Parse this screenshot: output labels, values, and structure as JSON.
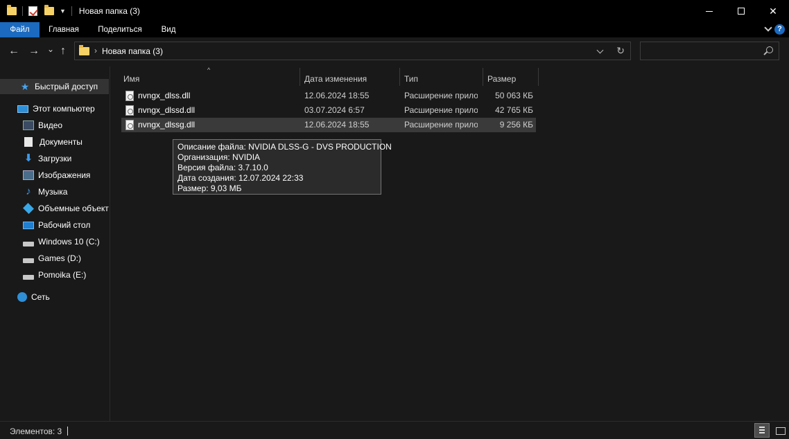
{
  "window": {
    "title": "Новая папка (3)",
    "minimize_glyph": "",
    "close_glyph": "✕"
  },
  "ribbon": {
    "tabs": [
      "Файл",
      "Главная",
      "Поделиться",
      "Вид"
    ],
    "active_tab": "Файл",
    "help_glyph": "?"
  },
  "nav": {
    "back_glyph": "←",
    "forward_glyph": "→",
    "recent_glyph": "⌄",
    "up_glyph": "↑",
    "address_separator": "›",
    "address_path": "Новая папка (3)",
    "refresh_glyph": "↻",
    "search_placeholder": ""
  },
  "sidebar": {
    "items": [
      {
        "label": "Быстрый доступ",
        "icon": "star-icon"
      },
      {
        "label": "Этот компьютер",
        "icon": "computer-icon"
      },
      {
        "label": "Видео",
        "icon": "video-folder-icon"
      },
      {
        "label": "Документы",
        "icon": "documents-folder-icon"
      },
      {
        "label": "Загрузки",
        "icon": "downloads-folder-icon"
      },
      {
        "label": "Изображения",
        "icon": "pictures-folder-icon"
      },
      {
        "label": "Музыка",
        "icon": "music-folder-icon"
      },
      {
        "label": "Объемные объекты",
        "icon": "3d-objects-icon"
      },
      {
        "label": "Рабочий стол",
        "icon": "desktop-icon"
      },
      {
        "label": "Windows 10 (C:)",
        "icon": "system-drive-icon"
      },
      {
        "label": "Games (D:)",
        "icon": "drive-icon"
      },
      {
        "label": "Pomoika (E:)",
        "icon": "drive-icon"
      },
      {
        "label": "Сеть",
        "icon": "network-icon"
      }
    ],
    "glyphs": {
      "star": "★",
      "downloads": "⬇",
      "music": "♪"
    }
  },
  "columns": {
    "name": "Имя",
    "date": "Дата изменения",
    "type": "Тип",
    "size": "Размер",
    "sort_glyph": "^"
  },
  "files": [
    {
      "name": "nvngx_dlss.dll",
      "date": "12.06.2024 18:55",
      "type": "Расширение приложения",
      "size": "50 063 КБ"
    },
    {
      "name": "nvngx_dlssd.dll",
      "date": "03.07.2024 6:57",
      "type": "Расширение приложения",
      "size": "42 765 КБ"
    },
    {
      "name": "nvngx_dlssg.dll",
      "date": "12.06.2024 18:55",
      "type": "Расширение приложения",
      "size": "9 256 КБ"
    }
  ],
  "tooltip": {
    "lines": [
      "Описание файла: NVIDIA DLSS-G - DVS PRODUCTION",
      "Организация: NVIDIA",
      "Версия файла: 3.7.10.0",
      "Дата создания: 12.07.2024 22:33",
      "Размер: 9,03 МБ"
    ]
  },
  "status": {
    "count_text": "Элементов: 3"
  },
  "colors": {
    "accent": "#1b6ac0",
    "background": "#191919",
    "selection": "#3a3a3a"
  }
}
